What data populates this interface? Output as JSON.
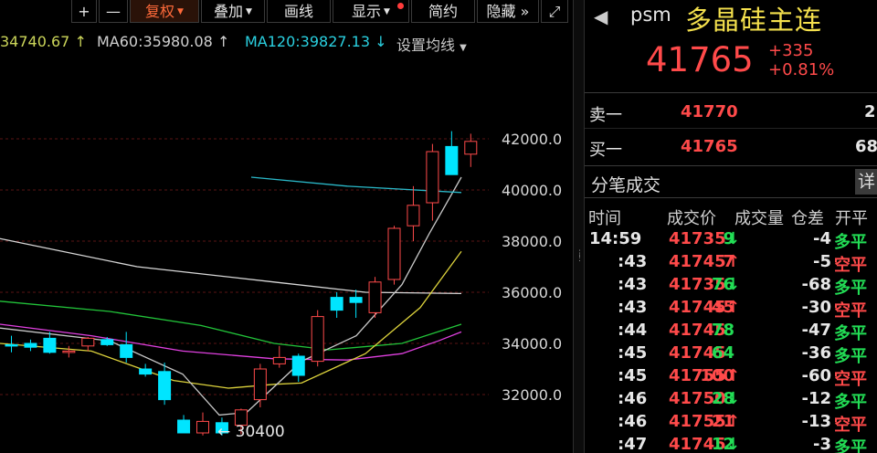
{
  "toolbar": {
    "plus": "+",
    "minus": "—",
    "fuquan": "复权",
    "diejia": "叠加",
    "huaxian": "画线",
    "xianshi": "显示",
    "jianyue": "简约",
    "yincang": "隐藏",
    "more": "»",
    "expand": "⤢"
  },
  "ma_legend": {
    "ma_partial": "34740.67",
    "ma60": "MA60:35980.08",
    "ma120": "MA120:39827.13",
    "settings": "设置均线"
  },
  "chart_data": {
    "type": "candlestick",
    "y_axis_ticks": [
      "42000.0",
      "40000.0",
      "38000.0",
      "36000.0",
      "34000.0",
      "32000.0"
    ],
    "ylim": [
      30000,
      43000
    ],
    "annotation": "30400",
    "colors": {
      "up": "#ff4a4a",
      "down": "#00e5ff",
      "ma_white": "#d8d8d8",
      "ma_yellow": "#dcd23c",
      "ma_magenta": "#e040e0",
      "ma_green": "#22c43a",
      "ma_cyan": "#2ab8c8",
      "grid": "#5a1414"
    },
    "candles": [
      {
        "o": 33950,
        "h": 34300,
        "l": 33650,
        "c": 33900
      },
      {
        "o": 34000,
        "h": 34150,
        "l": 33700,
        "c": 33850
      },
      {
        "o": 34200,
        "h": 34450,
        "l": 33600,
        "c": 33650
      },
      {
        "o": 33650,
        "h": 33900,
        "l": 33450,
        "c": 33700
      },
      {
        "o": 33900,
        "h": 34250,
        "l": 33700,
        "c": 34200
      },
      {
        "o": 34150,
        "h": 34250,
        "l": 33900,
        "c": 33950
      },
      {
        "o": 33950,
        "h": 34450,
        "l": 33250,
        "c": 33450
      },
      {
        "o": 33000,
        "h": 33200,
        "l": 32700,
        "c": 32800
      },
      {
        "o": 32900,
        "h": 33250,
        "l": 31600,
        "c": 31800
      },
      {
        "o": 31000,
        "h": 31200,
        "l": 30500,
        "c": 30500
      },
      {
        "o": 30500,
        "h": 31300,
        "l": 30400,
        "c": 30950
      },
      {
        "o": 30900,
        "h": 31100,
        "l": 30400,
        "c": 30500
      },
      {
        "o": 30800,
        "h": 31450,
        "l": 30450,
        "c": 31400
      },
      {
        "o": 31800,
        "h": 33200,
        "l": 31500,
        "c": 33000
      },
      {
        "o": 33200,
        "h": 33900,
        "l": 33050,
        "c": 33450
      },
      {
        "o": 33500,
        "h": 33600,
        "l": 32500,
        "c": 32750
      },
      {
        "o": 33300,
        "h": 35300,
        "l": 33100,
        "c": 35050
      },
      {
        "o": 35800,
        "h": 36000,
        "l": 35000,
        "c": 35300
      },
      {
        "o": 35800,
        "h": 36100,
        "l": 35000,
        "c": 35600
      },
      {
        "o": 35200,
        "h": 36600,
        "l": 35000,
        "c": 36400
      },
      {
        "o": 36500,
        "h": 38600,
        "l": 36300,
        "c": 38500
      },
      {
        "o": 38600,
        "h": 40150,
        "l": 38000,
        "c": 39400
      },
      {
        "o": 39500,
        "h": 41800,
        "l": 38800,
        "c": 41500
      },
      {
        "o": 41700,
        "h": 42300,
        "l": 40600,
        "c": 40600
      },
      {
        "o": 41400,
        "h": 42200,
        "l": 40900,
        "c": 41900
      }
    ],
    "ma_lines": {
      "white": [
        [
          0,
          38100
        ],
        [
          150,
          37000
        ],
        [
          300,
          36400
        ],
        [
          400,
          36000
        ],
        [
          505,
          35950
        ]
      ],
      "magenta": [
        [
          0,
          34750
        ],
        [
          100,
          34300
        ],
        [
          200,
          33700
        ],
        [
          300,
          33400
        ],
        [
          380,
          33350
        ],
        [
          440,
          33600
        ],
        [
          480,
          34100
        ],
        [
          505,
          34450
        ]
      ],
      "green": [
        [
          0,
          35650
        ],
        [
          120,
          35250
        ],
        [
          220,
          34700
        ],
        [
          300,
          34000
        ],
        [
          360,
          33750
        ],
        [
          440,
          34000
        ],
        [
          505,
          34750
        ]
      ],
      "yellow": [
        [
          0,
          34000
        ],
        [
          100,
          33700
        ],
        [
          190,
          32550
        ],
        [
          250,
          32250
        ],
        [
          300,
          32400
        ],
        [
          330,
          32450
        ],
        [
          400,
          33600
        ],
        [
          460,
          35400
        ],
        [
          505,
          37600
        ]
      ],
      "gray": [
        [
          0,
          34600
        ],
        [
          120,
          34100
        ],
        [
          200,
          32800
        ],
        [
          240,
          31200
        ],
        [
          270,
          31300
        ],
        [
          330,
          33300
        ],
        [
          390,
          34300
        ],
        [
          440,
          36300
        ],
        [
          470,
          38300
        ],
        [
          505,
          40500
        ]
      ],
      "cyan": [
        [
          275,
          40500
        ],
        [
          380,
          40150
        ],
        [
          505,
          39900
        ]
      ]
    }
  },
  "right_panel": {
    "nav": "◀",
    "symbol": "psm",
    "name": "多晶硅主连",
    "price": "41765",
    "change": "+335",
    "change_pct": "+0.81%",
    "sell_label": "卖一",
    "sell_price": "41770",
    "sell_qty": "2",
    "buy_label": "买一",
    "buy_price": "41765",
    "buy_qty": "68",
    "trades_title": "分笔成交",
    "detail": "详",
    "headers": [
      "时间",
      "成交价",
      "成交量",
      "仓差",
      "开平"
    ],
    "trades": [
      {
        "t": "14:59",
        "p": "41735",
        "dir": "down",
        "v": "9",
        "d": "-4",
        "k": "多平",
        "kc": "green"
      },
      {
        "t": ":43",
        "p": "41745",
        "dir": "up",
        "v": "7",
        "d": "-5",
        "k": "空平",
        "kc": "red"
      },
      {
        "t": ":43",
        "p": "41735",
        "dir": "down",
        "v": "76",
        "d": "-68",
        "k": "多平",
        "kc": "green"
      },
      {
        "t": ":43",
        "p": "41745",
        "dir": "up",
        "v": "45",
        "d": "-30",
        "k": "空平",
        "kc": "red"
      },
      {
        "t": ":44",
        "p": "41745",
        "dir": "none",
        "v": "78",
        "d": "-47",
        "k": "多平",
        "kc": "green"
      },
      {
        "t": ":45",
        "p": "41745",
        "dir": "none",
        "v": "64",
        "d": "-36",
        "k": "多平",
        "kc": "green"
      },
      {
        "t": ":45",
        "p": "41755",
        "dir": "up",
        "v": "100",
        "d": "-60",
        "k": "空平",
        "kc": "red"
      },
      {
        "t": ":46",
        "p": "41750",
        "dir": "down",
        "v": "28",
        "d": "-12",
        "k": "多平",
        "kc": "green"
      },
      {
        "t": ":46",
        "p": "41755",
        "dir": "up",
        "v": "21",
        "d": "-13",
        "k": "空平",
        "kc": "red"
      },
      {
        "t": ":47",
        "p": "41745",
        "dir": "down",
        "v": "12",
        "d": "-3",
        "k": "多平",
        "kc": "green"
      }
    ]
  }
}
